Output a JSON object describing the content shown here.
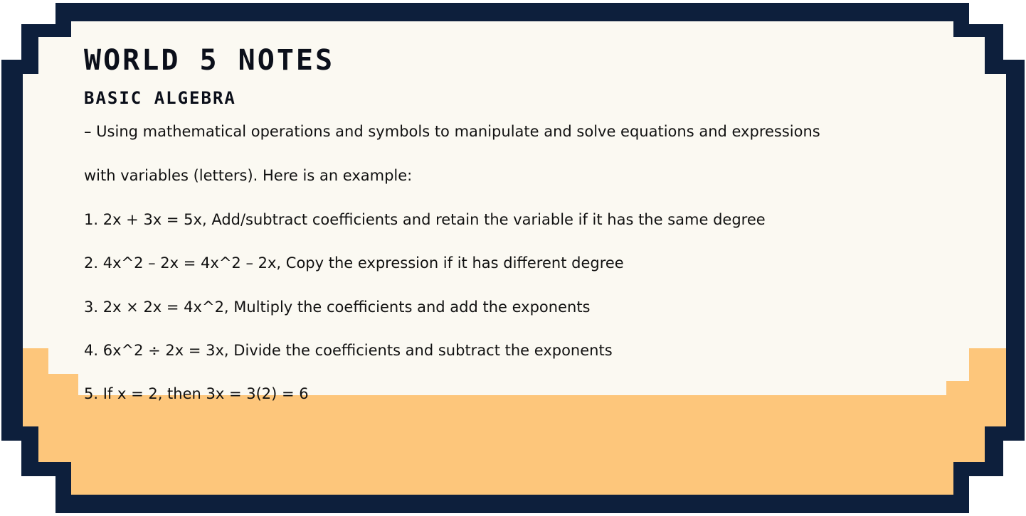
{
  "notes": {
    "title": "WORLD 5 NOTES",
    "subtitle": "BASIC ALGEBRA",
    "intro_line_1": "– Using mathematical operations and symbols to manipulate and solve equations and expressions",
    "intro_line_2": "with variables (letters). Here is an example:",
    "examples": [
      "1. 2x + 3x = 5x, Add/subtract coefficients and retain the variable if it has the same degree",
      "2. 4x^2 – 2x = 4x^2 – 2x, Copy the expression if it has different degree",
      "3. 2x × 2x = 4x^2, Multiply the coefficients and add the exponents",
      "4. 6x^2 ÷ 2x = 3x, Divide the coefficients and subtract the exponents",
      "5. If x = 2, then 3x = 3(2) = 6"
    ]
  },
  "colors": {
    "frame_border": "#0d1f3c",
    "paper": "#fbf9f2",
    "sand": "#fdc67b",
    "text": "#111111"
  }
}
